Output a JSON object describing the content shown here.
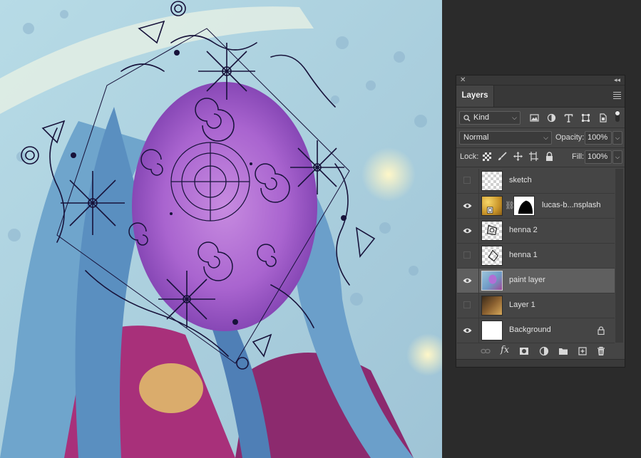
{
  "panel": {
    "title": "Layers",
    "filter": {
      "label": "Kind"
    },
    "blend_mode": "Normal",
    "opacity": {
      "label": "Opacity:",
      "value": "100%"
    },
    "lock": {
      "label": "Lock:"
    },
    "fill": {
      "label": "Fill:",
      "value": "100%"
    }
  },
  "layers": [
    {
      "name": "sketch",
      "visible": false,
      "selected": false
    },
    {
      "name": "lucas-b...nsplash",
      "visible": true,
      "selected": false
    },
    {
      "name": "henna 2",
      "visible": true,
      "selected": false
    },
    {
      "name": "henna 1",
      "visible": false,
      "selected": false
    },
    {
      "name": "paint layer",
      "visible": true,
      "selected": true
    },
    {
      "name": "Layer 1",
      "visible": false,
      "selected": false
    },
    {
      "name": "Background",
      "visible": true,
      "selected": false,
      "locked": true
    }
  ],
  "icons": {
    "filter": [
      "search-icon",
      "image-filter-icon",
      "adjustment-filter-icon",
      "type-filter-icon",
      "shape-filter-icon",
      "smart-object-filter-icon",
      "filter-toggle-icon"
    ],
    "lock": [
      "lock-transparent-icon",
      "lock-image-icon",
      "lock-position-icon",
      "lock-artboard-icon",
      "lock-all-icon"
    ],
    "footer": [
      "link-layers-icon",
      "fx-icon",
      "add-mask-icon",
      "adjustment-layer-icon",
      "new-group-icon",
      "new-layer-icon",
      "delete-layer-icon"
    ]
  },
  "colors": {
    "panel_bg": "#454545",
    "selected_row": "#5f5f5f",
    "workspace": "#2b2b2b"
  }
}
